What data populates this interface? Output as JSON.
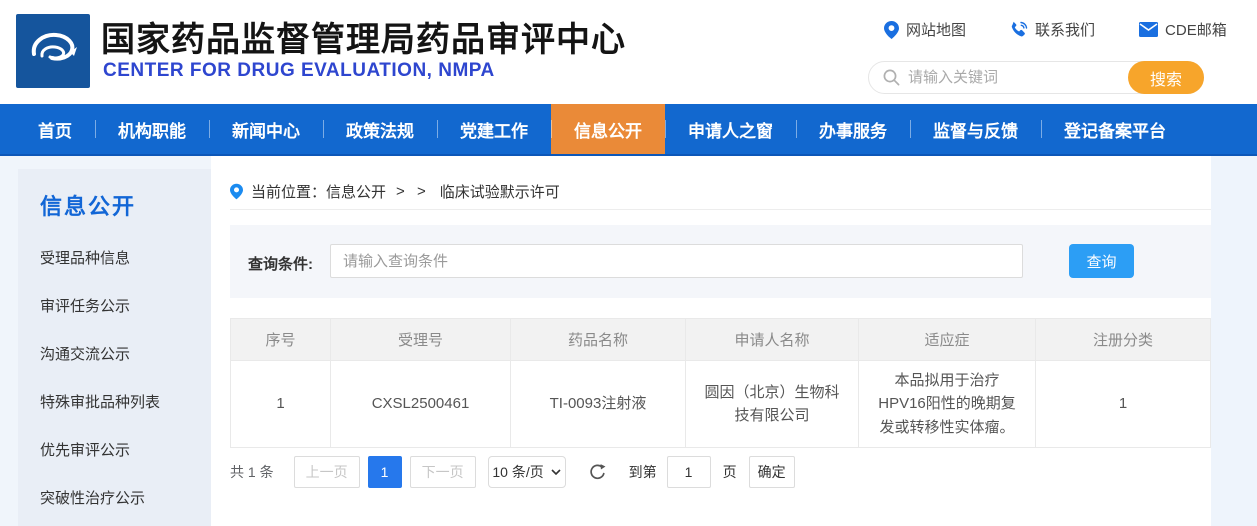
{
  "header": {
    "title": "国家药品监督管理局药品审评中心",
    "subtitle": "CENTER FOR DRUG EVALUATION, NMPA",
    "links": [
      {
        "icon": "map-pin-icon",
        "label": "网站地图"
      },
      {
        "icon": "phone-icon",
        "label": "联系我们"
      },
      {
        "icon": "mail-icon",
        "label": "CDE邮箱"
      }
    ],
    "search": {
      "placeholder": "请输入关键词",
      "button_label": "搜索"
    }
  },
  "nav": {
    "items": [
      {
        "label": "首页",
        "active": false
      },
      {
        "label": "机构职能",
        "active": false
      },
      {
        "label": "新闻中心",
        "active": false
      },
      {
        "label": "政策法规",
        "active": false
      },
      {
        "label": "党建工作",
        "active": false
      },
      {
        "label": "信息公开",
        "active": true
      },
      {
        "label": "申请人之窗",
        "active": false
      },
      {
        "label": "办事服务",
        "active": false
      },
      {
        "label": "监督与反馈",
        "active": false
      },
      {
        "label": "登记备案平台",
        "active": false
      }
    ]
  },
  "sidebar": {
    "title": "信息公开",
    "items": [
      "受理品种信息",
      "审评任务公示",
      "沟通交流公示",
      "特殊审批品种列表",
      "优先审评公示",
      "突破性治疗公示"
    ]
  },
  "breadcrumb": {
    "label": "当前位置：",
    "section": "信息公开",
    "separator": "> >",
    "current": "临床试验默示许可"
  },
  "query": {
    "label": "查询条件:",
    "placeholder": "请输入查询条件",
    "button_label": "查询"
  },
  "table": {
    "headers": [
      "序号",
      "受理号",
      "药品名称",
      "申请人名称",
      "适应症",
      "注册分类"
    ],
    "rows": [
      [
        "1",
        "CXSL2500461",
        "TI-0093注射液",
        "圆因（北京）生物科技有限公司",
        "本品拟用于治疗HPV16阳性的晚期复发或转移性实体瘤。",
        "1"
      ]
    ]
  },
  "pagination": {
    "total": "共 1 条",
    "prev_label": "上一页",
    "current_page": "1",
    "next_label": "下一页",
    "page_size": "10 条/页",
    "goto_label": "到第",
    "goto_value": "1",
    "page_unit": "页",
    "confirm_label": "确定"
  },
  "colors": {
    "nav_blue": "#1268cf",
    "active_tab_orange": "#ea8a38",
    "search_button_orange": "#f7a52b",
    "query_button_blue": "#2c9ef5",
    "active_page_blue": "#2678ec",
    "sidebar_title_blue": "#1266d6",
    "subtitle_blue": "#2e46cf"
  }
}
